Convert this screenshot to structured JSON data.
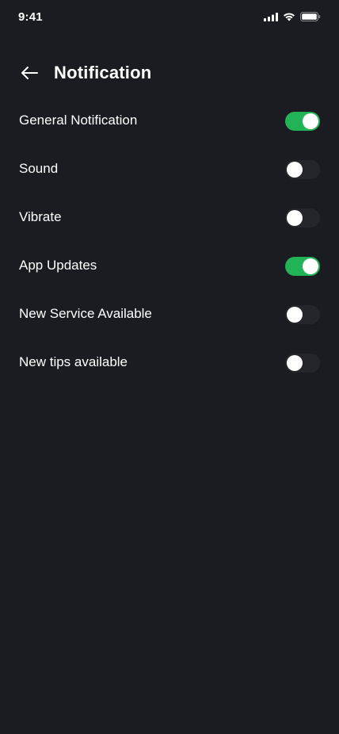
{
  "status_bar": {
    "time": "9:41",
    "icons": [
      "cellular-signal-icon",
      "wifi-icon",
      "battery-icon"
    ]
  },
  "header": {
    "back_icon": "arrow-left-icon",
    "title": "Notification"
  },
  "colors": {
    "background": "#1b1c21",
    "toggle_on": "#22b356",
    "toggle_off": "#25262c",
    "text": "#ffffff"
  },
  "settings": [
    {
      "label": "General Notification",
      "enabled": true
    },
    {
      "label": "Sound",
      "enabled": false
    },
    {
      "label": "Vibrate",
      "enabled": false
    },
    {
      "label": "App Updates",
      "enabled": true
    },
    {
      "label": "New Service Available",
      "enabled": false
    },
    {
      "label": "New tips available",
      "enabled": false
    }
  ]
}
